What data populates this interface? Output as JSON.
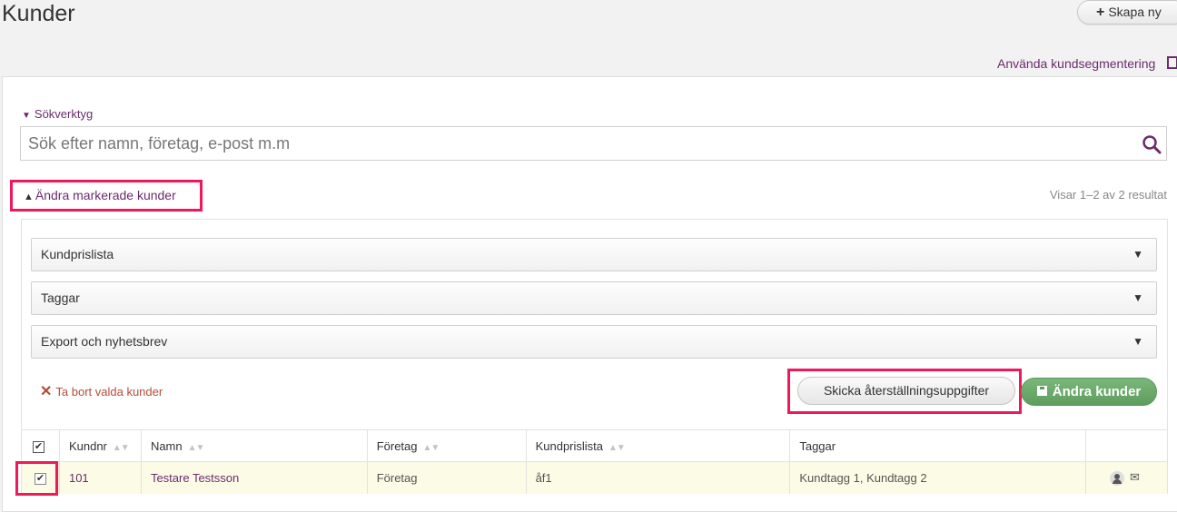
{
  "header": {
    "title": "Kunder",
    "create_label": "Skapa ny",
    "segmentation_link": "Använda kundsegmentering"
  },
  "search": {
    "toggle_label": "Sökverktyg",
    "placeholder": "Sök efter namn, företag, e-post m.m"
  },
  "bulk": {
    "toggle_label": "Ändra markerade kunder",
    "result_text": "Visar 1–2 av 2 resultat",
    "dropdowns": [
      "Kundprislista",
      "Taggar",
      "Export och nyhetsbrev"
    ],
    "remove_label": "Ta bort valda kunder",
    "reset_label": "Skicka återställningsuppgifter",
    "change_label": "Ändra kunder"
  },
  "table": {
    "columns": [
      "Kundnr",
      "Namn",
      "Företag",
      "Kundprislista",
      "Taggar"
    ],
    "rows": [
      {
        "kundnr": "101",
        "namn": "Testare Testsson",
        "foretag": "Företag",
        "prislista": "åf1",
        "taggar": "Kundtagg 1, Kundtagg 2",
        "checked": true
      }
    ]
  },
  "colors": {
    "accent": "#6b2c6e",
    "highlight": "#f0185a",
    "primary_button": "#6aa96a",
    "danger": "#b74a3b"
  }
}
